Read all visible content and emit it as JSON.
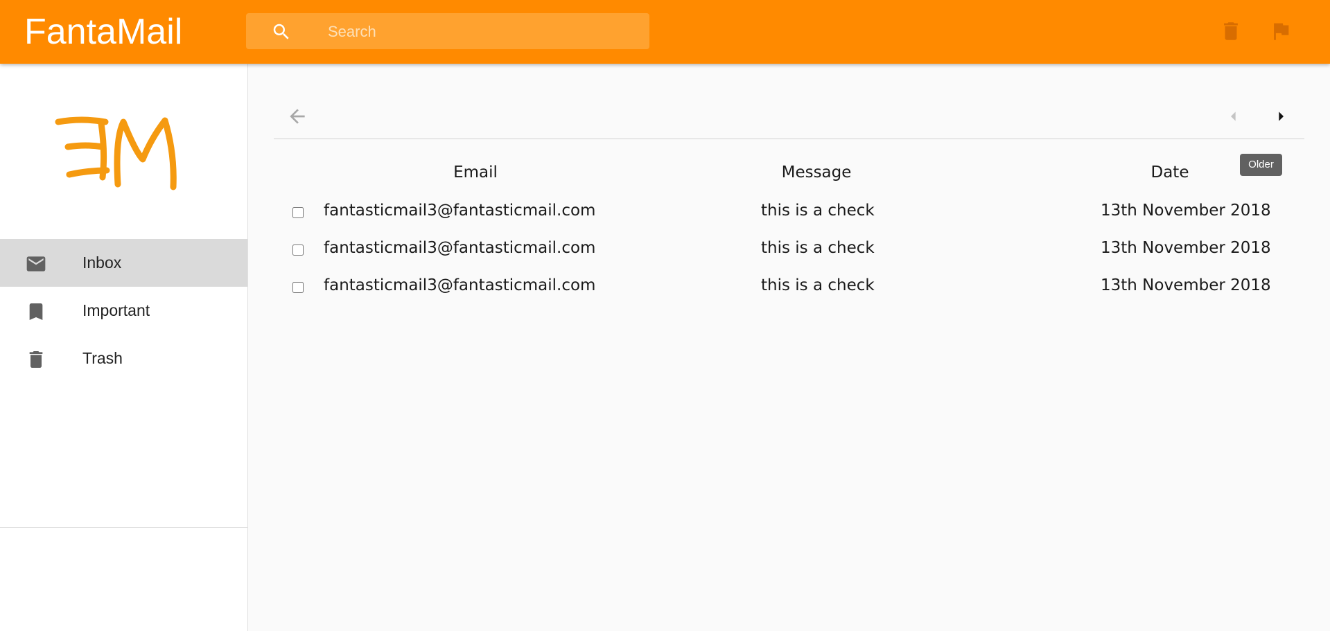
{
  "app": {
    "title": "FantaMail"
  },
  "search": {
    "placeholder": "Search",
    "value": ""
  },
  "header_actions": [
    {
      "icon": "trash-icon",
      "color": "#d86d00"
    },
    {
      "icon": "flag-icon",
      "color": "#d86d00"
    }
  ],
  "colors": {
    "accent": "#ff8a00",
    "search_bg": "#ffa22f",
    "logo": "#f59a10",
    "active_nav": "#dadada"
  },
  "logo": {
    "text": "FM"
  },
  "sidebar": {
    "items": [
      {
        "label": "Inbox",
        "icon": "mail-icon",
        "active": true
      },
      {
        "label": "Important",
        "icon": "bookmark-icon",
        "active": false
      },
      {
        "label": "Trash",
        "icon": "trash-icon",
        "active": false
      }
    ]
  },
  "toolbar": {
    "back_icon": "arrow-back-icon",
    "prev_icon": "chevron-left-icon",
    "next_icon": "chevron-right-icon",
    "tooltip": "Older"
  },
  "table": {
    "columns": [
      "Email",
      "Message",
      "Date"
    ],
    "rows": [
      {
        "email": "fantasticmail3@fantasticmail.com",
        "message": "this is a check",
        "date": "13th November 2018",
        "checked": false
      },
      {
        "email": "fantasticmail3@fantasticmail.com",
        "message": "this is a check",
        "date": "13th November 2018",
        "checked": false
      },
      {
        "email": "fantasticmail3@fantasticmail.com",
        "message": "this is a check",
        "date": "13th November 2018",
        "checked": false
      }
    ]
  }
}
